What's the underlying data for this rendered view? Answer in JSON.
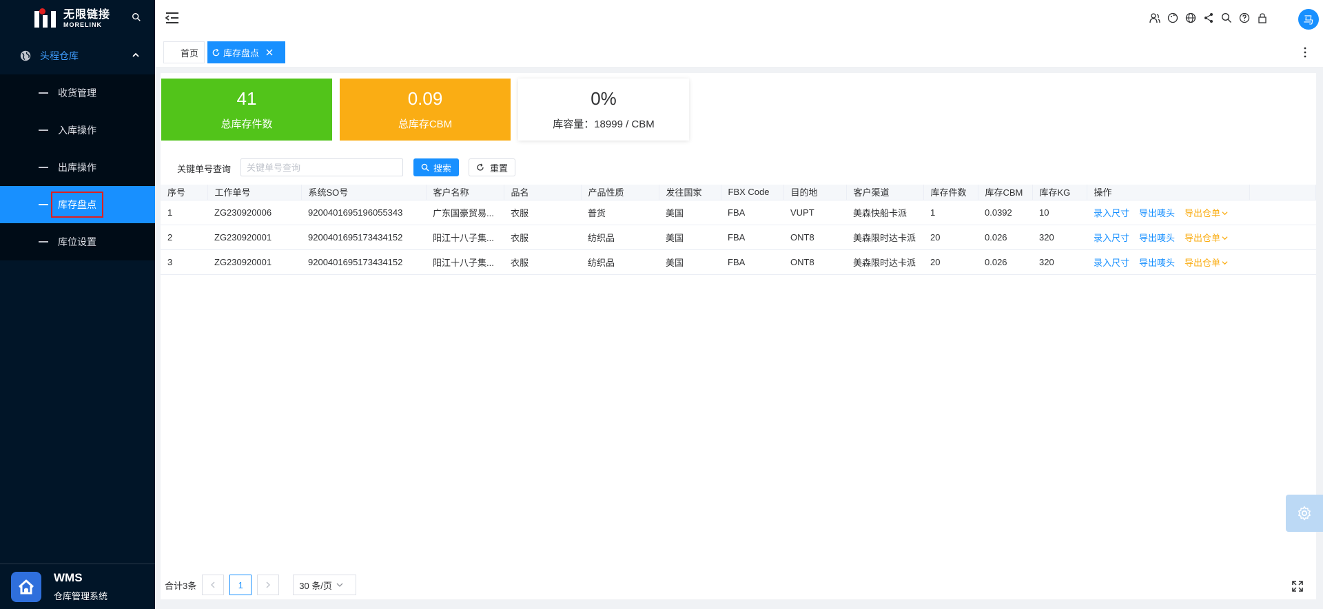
{
  "brand": {
    "name_cn": "无限链接",
    "name_en": "MORELINK"
  },
  "sidebar": {
    "group": {
      "label": "头程仓库",
      "icon": "globe-icon"
    },
    "items": [
      {
        "label": "收货管理",
        "active": false
      },
      {
        "label": "入库操作",
        "active": false
      },
      {
        "label": "出库操作",
        "active": false
      },
      {
        "label": "库存盘点",
        "active": true
      },
      {
        "label": "库位设置",
        "active": false
      }
    ],
    "footer": {
      "title": "WMS",
      "subtitle": "仓库管理系统",
      "icon": "home-icon"
    }
  },
  "header": {
    "icons": [
      "users-icon",
      "tag-icon",
      "globe-icon",
      "share-icon",
      "search-icon",
      "help-icon",
      "lock-icon"
    ],
    "avatar_text": "马"
  },
  "tabs": [
    {
      "label": "首页",
      "active": false
    },
    {
      "label": "库存盘点",
      "active": true
    }
  ],
  "stats": {
    "total_pieces": {
      "value": "41",
      "label": "总库存件数"
    },
    "total_cbm": {
      "value": "0.09",
      "label": "总库存CBM"
    },
    "capacity": {
      "value": "0%",
      "label": "库容量：18999 / CBM"
    }
  },
  "search": {
    "label": "关键单号查询",
    "placeholder": "关键单号查询",
    "search_btn": "搜索",
    "reset_btn": "重置"
  },
  "table": {
    "columns": [
      "序号",
      "工作单号",
      "系统SO号",
      "客户名称",
      "品名",
      "产品性质",
      "发往国家",
      "FBX Code",
      "目的地",
      "客户渠道",
      "库存件数",
      "库存CBM",
      "库存KG",
      "操作"
    ],
    "rows": [
      {
        "no": "1",
        "job": "ZG230920006",
        "so": "9200401695196055343",
        "customer": "广东国豪贸易...",
        "product": "衣服",
        "nature": "普货",
        "country": "美国",
        "fbx": "FBA",
        "dest": "VUPT",
        "channel": "美森快船卡派",
        "pieces": "1",
        "cbm": "0.0392",
        "kg": "10"
      },
      {
        "no": "2",
        "job": "ZG230920001",
        "so": "9200401695173434152",
        "customer": "阳江十八子集...",
        "product": "衣服",
        "nature": "纺织品",
        "country": "美国",
        "fbx": "FBA",
        "dest": "ONT8",
        "channel": "美森限时达卡派",
        "pieces": "20",
        "cbm": "0.026",
        "kg": "320"
      },
      {
        "no": "3",
        "job": "ZG230920001",
        "so": "9200401695173434152",
        "customer": "阳江十八子集...",
        "product": "衣服",
        "nature": "纺织品",
        "country": "美国",
        "fbx": "FBA",
        "dest": "ONT8",
        "channel": "美森限时达卡派",
        "pieces": "20",
        "cbm": "0.026",
        "kg": "320"
      }
    ],
    "actions": {
      "enter_size": "录入尺寸",
      "export_mark": "导出唛头",
      "export_doc": "导出仓单"
    }
  },
  "pagination": {
    "total": "合计3条",
    "current_page": "1",
    "page_size": "30 条/页"
  },
  "colors": {
    "primary": "#1890ff",
    "green": "#52c41a",
    "orange": "#faad14",
    "sidebar_bg": "#011528"
  }
}
